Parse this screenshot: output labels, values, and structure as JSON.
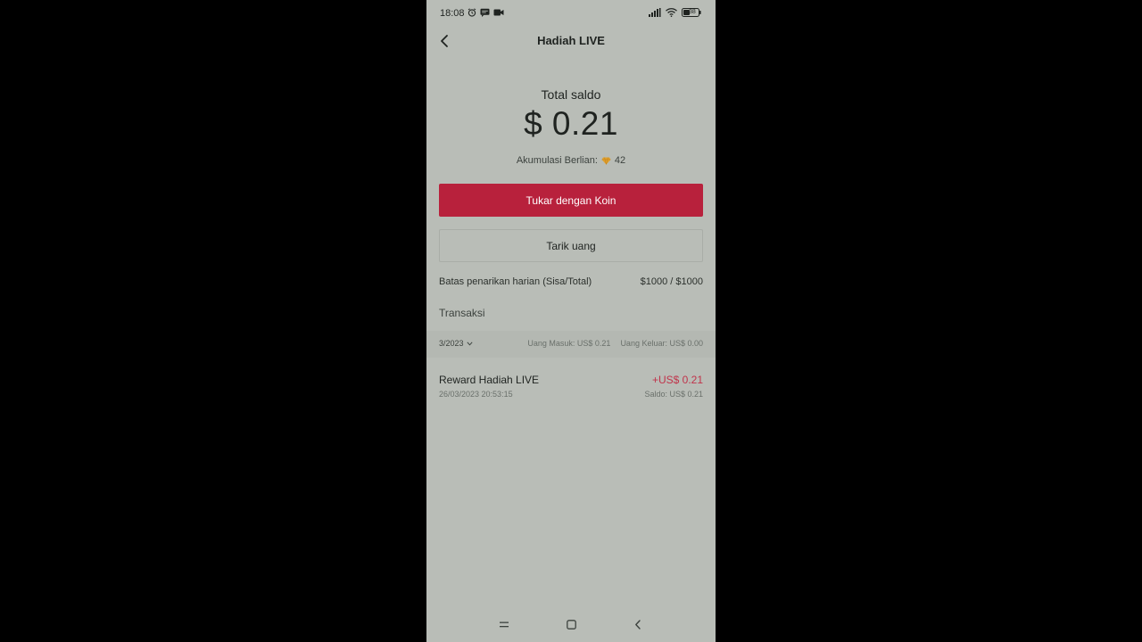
{
  "status_bar": {
    "time": "18:08",
    "battery": "38",
    "icons": [
      "alarm-icon",
      "message-icon",
      "video-icon",
      "signal-icon",
      "wifi-icon",
      "battery-icon"
    ]
  },
  "header": {
    "title": "Hadiah LIVE",
    "back_icon": "chevron-left-icon"
  },
  "balance": {
    "label": "Total saldo",
    "amount": "$ 0.21",
    "diamonds_label": "Akumulasi Berlian:",
    "diamonds_icon": "diamond-icon",
    "diamonds_value": "42"
  },
  "actions": {
    "exchange_label": "Tukar dengan Koin",
    "withdraw_label": "Tarik uang"
  },
  "limit": {
    "label": "Batas penarikan harian (Sisa/Total)",
    "value": "$1000 / $1000"
  },
  "transactions": {
    "title": "Transaksi",
    "month": "3/2023",
    "money_in": "Uang Masuk: US$ 0.21",
    "money_out": "Uang Keluar: US$ 0.00",
    "items": [
      {
        "title": "Reward Hadiah LIVE",
        "date": "26/03/2023 20:53:15",
        "amount": "+US$ 0.21",
        "balance": "Saldo: US$ 0.21"
      }
    ]
  },
  "colors": {
    "background": "#b9bdb7",
    "primary_button": "#b8213c",
    "positive_amount": "#c0334a",
    "diamond": "#e0a12e"
  }
}
